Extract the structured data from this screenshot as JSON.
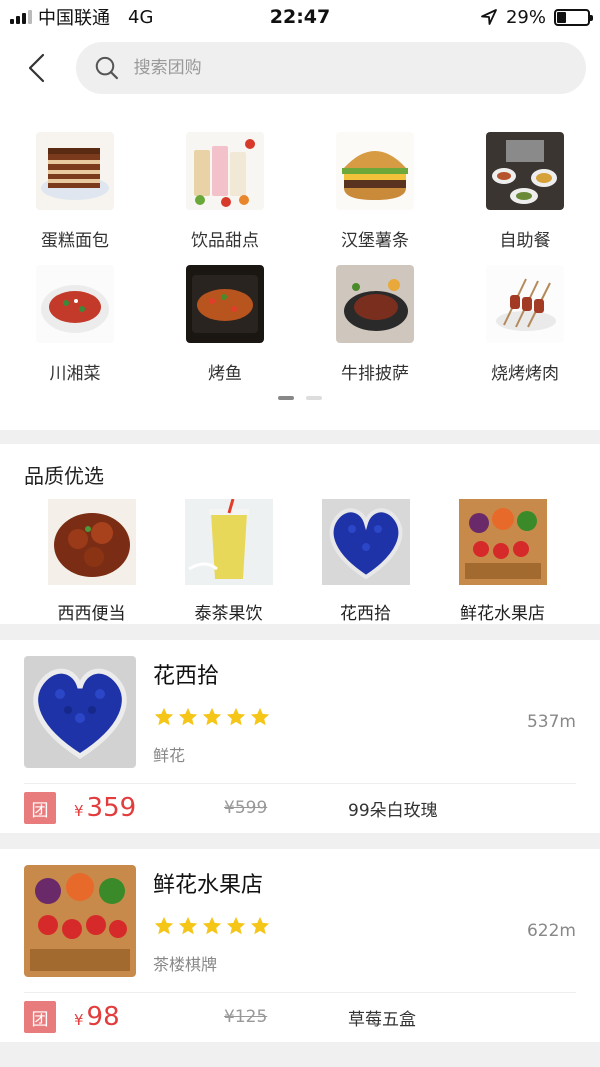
{
  "status_bar": {
    "carrier": "中国联通",
    "network": "4G",
    "time": "22:47",
    "battery": "29%",
    "battery_level": 0.29
  },
  "search": {
    "placeholder": "搜索团购",
    "back_icon": "chevron-left-icon",
    "search_icon": "search-icon"
  },
  "categories": {
    "items": [
      {
        "label": "蛋糕面包"
      },
      {
        "label": "饮品甜点"
      },
      {
        "label": "汉堡薯条"
      },
      {
        "label": "自助餐"
      },
      {
        "label": "川湘菜"
      },
      {
        "label": "烤鱼"
      },
      {
        "label": "牛排披萨"
      },
      {
        "label": "烧烤烤肉"
      }
    ],
    "page_count": 2,
    "active_page": 1
  },
  "quality": {
    "title": "品质优选",
    "items": [
      {
        "label": "西西便当"
      },
      {
        "label": "泰茶果饮"
      },
      {
        "label": "花西拾"
      },
      {
        "label": "鲜花水果店"
      }
    ]
  },
  "listings": [
    {
      "name": "花西拾",
      "rating": 5,
      "distance": "537m",
      "tag": "鲜花",
      "tuan_label": "团",
      "currency": "¥",
      "price": "359",
      "original_price": "¥599",
      "deal": "99朵白玫瑰"
    },
    {
      "name": "鲜花水果店",
      "rating": 5,
      "distance": "622m",
      "tag": "茶楼棋牌",
      "tuan_label": "团",
      "currency": "¥",
      "price": "98",
      "original_price": "¥125",
      "deal": "草莓五盒"
    }
  ],
  "colors": {
    "accent_red": "#e23c3c",
    "tuan_badge": "#e87b7b",
    "star": "#f5c518"
  }
}
